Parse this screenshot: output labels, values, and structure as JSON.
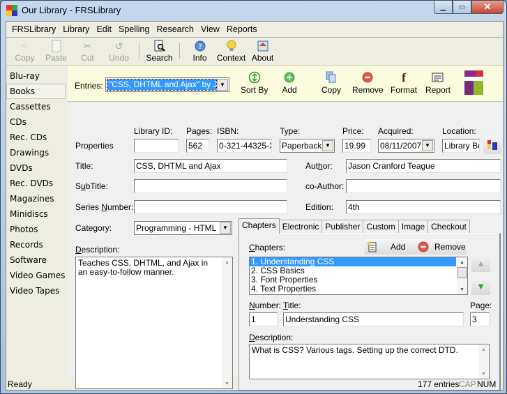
{
  "window": {
    "title": "Our Library - FRSLibrary",
    "min_icon": "minimize-icon",
    "max_icon": "maximize-icon",
    "close_icon": "close-icon",
    "close_glyph": "✕",
    "max_glyph": "▭",
    "min_glyph": "▁"
  },
  "menu": [
    "FRSLibrary",
    "Library",
    "Edit",
    "Spelling",
    "Research",
    "View",
    "Reports"
  ],
  "toolbar": {
    "copy": "Copy",
    "paste": "Paste",
    "cut": "Cut",
    "undo": "Undo",
    "search": "Search",
    "info": "Info",
    "context": "Context",
    "about": "About"
  },
  "sidebar": {
    "items": [
      "Blu-ray",
      "Books",
      "Cassettes",
      "CDs",
      "Rec. CDs",
      "Drawings",
      "DVDs",
      "Rec. DVDs",
      "Magazines",
      "Minidiscs",
      "Photos",
      "Records",
      "Software",
      "Video Games",
      "Video Tapes"
    ],
    "selected": "Books"
  },
  "entries": {
    "label": "Entries:",
    "value": "\"CSS, DHTML and Ajax\" by Jaso",
    "sort_by": "Sort By",
    "add": "Add",
    "copy": "Copy",
    "remove": "Remove",
    "format": "Format",
    "report": "Report"
  },
  "properties": {
    "section_label": "Properties",
    "library_id_label": "Library ID:",
    "library_id": "",
    "pages_label": "Pages:",
    "pages": "562",
    "isbn_label": "ISBN:",
    "isbn": "0-321-44325-X",
    "type_label": "Type:",
    "type": "Paperback",
    "price_label": "Price:",
    "price": "19.99",
    "acquired_label": "Acquired:",
    "acquired": "08/11/2007",
    "location_label": "Location:",
    "location": "Library Boo"
  },
  "fields": {
    "title_label": "Title:",
    "title": "CSS, DHTML and Ajax",
    "subtitle_label": "SubTitle:",
    "subtitle": "",
    "series_label": "Series Number:",
    "series": "",
    "author_label": "Author:",
    "author": "Jason Cranford Teague",
    "coauthor_label": "co-Author:",
    "coauthor": "",
    "edition_label": "Edition:",
    "edition": "4th",
    "category_label": "Category:",
    "category": "Programming - HTML",
    "description_label": "Description:",
    "description": "Teaches CSS, DHTML, and Ajax in an easy-to-follow manner."
  },
  "tabs": [
    "Chapters",
    "Electronic",
    "Publisher",
    "Custom",
    "Image",
    "Checkout"
  ],
  "active_tab": "Chapters",
  "chapters": {
    "label": "Chapters:",
    "add": "Add",
    "remove": "Remove",
    "items": [
      "1. Understanding CSS",
      "2. CSS Basics",
      "3. Font Properties",
      "4. Text Properties"
    ],
    "selected_index": 0,
    "number_label": "Number:",
    "number": "1",
    "title_label": "Title:",
    "title": "Understanding CSS",
    "page_label": "Page:",
    "page": "3",
    "description_label": "Description:",
    "description": "What is CSS? Various tags. Setting up the correct DTD."
  },
  "status": {
    "text": "Ready",
    "entries": "177 entries",
    "cap": "CAP",
    "num": "NUM"
  }
}
